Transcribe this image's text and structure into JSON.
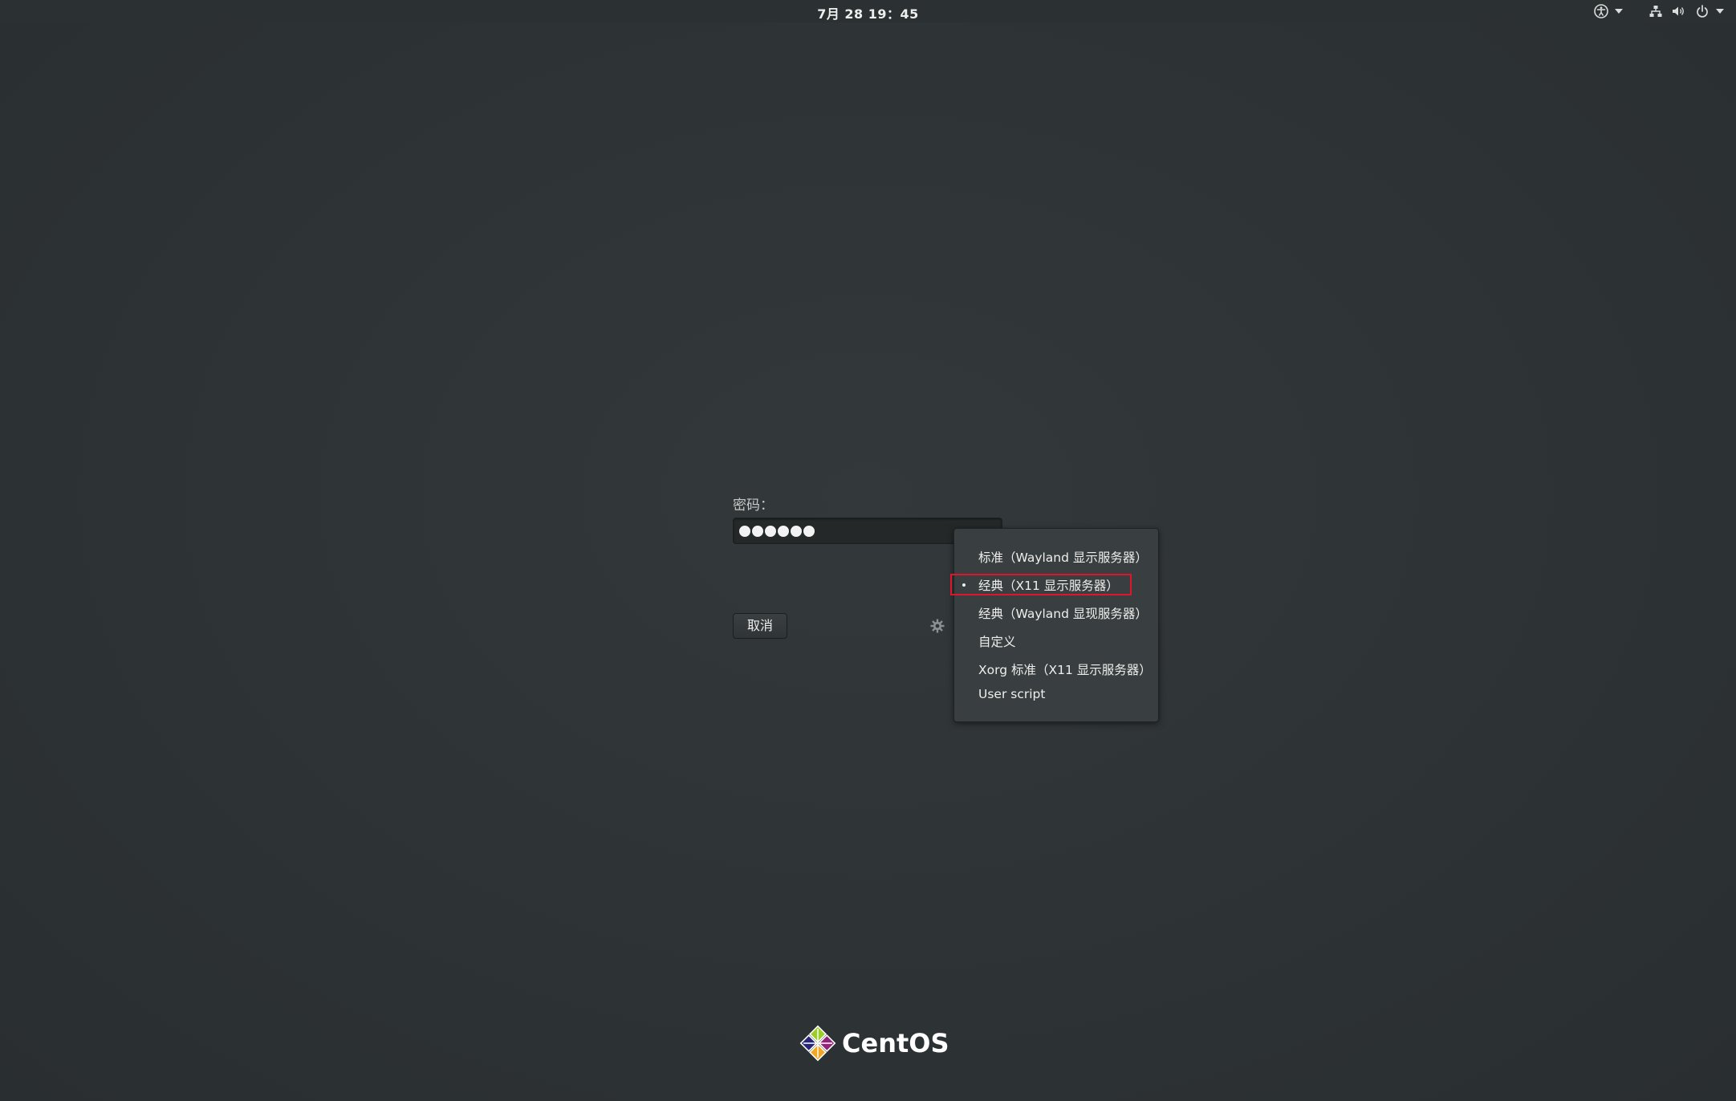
{
  "topbar": {
    "clock": "7月 28  19：45",
    "icons": [
      "accessibility-icon",
      "network-icon",
      "volume-icon",
      "power-icon"
    ]
  },
  "login": {
    "password_label": "密码：",
    "password_dots": 6,
    "cancel_label": "取消"
  },
  "session_menu": {
    "items": [
      {
        "label": "标准（Wayland 显示服务器）",
        "selected": false
      },
      {
        "label": "经典（X11 显示服务器）",
        "selected": true
      },
      {
        "label": "经典（Wayland 显现服务器）",
        "selected": false
      },
      {
        "label": "自定义",
        "selected": false
      },
      {
        "label": "Xorg 标准（X11 显示服务器）",
        "selected": false
      },
      {
        "label": "User script",
        "selected": false
      }
    ]
  },
  "branding": {
    "logo_text": "CentOS"
  },
  "colors": {
    "background": "#2e3436",
    "highlight": "#e0142a"
  }
}
